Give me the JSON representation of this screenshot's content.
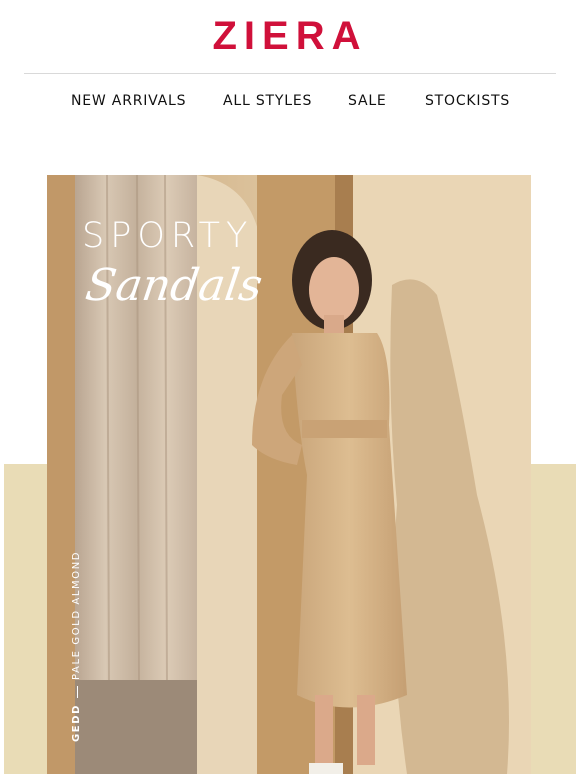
{
  "brand": {
    "name": "ZIERA",
    "color": "#d0103a"
  },
  "nav": {
    "items": [
      {
        "label": "NEW ARRIVALS"
      },
      {
        "label": "ALL STYLES"
      },
      {
        "label": "SALE"
      },
      {
        "label": "STOCKISTS"
      }
    ]
  },
  "hero": {
    "headline_line1": "SPORTY",
    "headline_line2": "Sandals",
    "caption_model": "GEDD",
    "caption_color": "PALE GOLD ALMOND",
    "band_color": "#e9dcb6"
  }
}
